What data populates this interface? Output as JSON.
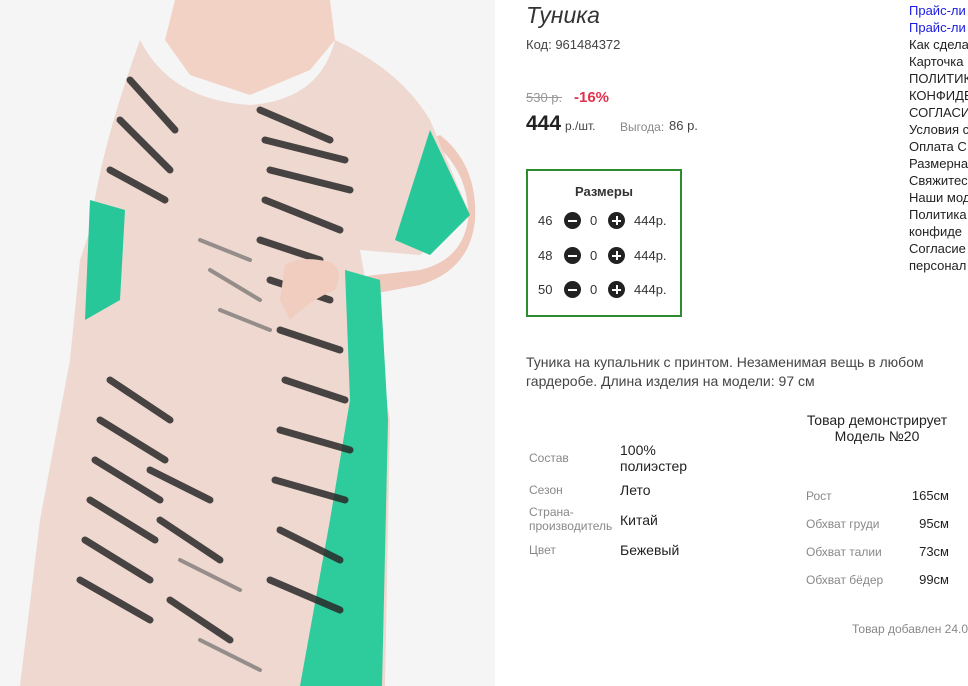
{
  "product": {
    "title": "Туника",
    "code": "Код: 961484372",
    "old_price": "530 р.",
    "discount": "-16%",
    "price": "444",
    "price_unit": "р./шт.",
    "savings_label": "Выгода:",
    "savings_value": "86 р."
  },
  "sizes": {
    "title": "Размеры",
    "rows": [
      {
        "size": "46",
        "qty": "0",
        "price": "444р."
      },
      {
        "size": "48",
        "qty": "0",
        "price": "444р."
      },
      {
        "size": "50",
        "qty": "0",
        "price": "444р."
      }
    ]
  },
  "description": "Туника на купальник с принтом. Незаменимая вещь в любом гардеробе. Длина изделия на модели: 97 см",
  "attributes": [
    {
      "label": "Состав",
      "value": "100% полиэстер"
    },
    {
      "label": "Сезон",
      "value": "Лето"
    },
    {
      "label": "Страна-производитель",
      "value": "Китай"
    },
    {
      "label": "Цвет",
      "value": "Бежевый"
    }
  ],
  "model": {
    "title": "Товар демонстрирует Модель №20",
    "measurements": [
      {
        "label": "Рост",
        "value": "165см"
      },
      {
        "label": "Обхват груди",
        "value": "95см"
      },
      {
        "label": "Обхват талии",
        "value": "73см"
      },
      {
        "label": "Обхват бёдер",
        "value": "99см"
      }
    ]
  },
  "added_text": "Товар добавлен 24.0",
  "side_links": [
    {
      "label": "Прайс-ли",
      "link": true
    },
    {
      "label": "Прайс-ли",
      "link": true
    },
    {
      "label": "Как сдела",
      "link": false
    },
    {
      "label": "Карточка",
      "link": false
    },
    {
      "label": "ПОЛИТИК",
      "link": false
    },
    {
      "label": "КОНФИДЕ",
      "link": false
    },
    {
      "label": "СОГЛАСИ",
      "link": false
    },
    {
      "label": "Условия с",
      "link": false
    },
    {
      "label": "Оплата С",
      "link": false
    },
    {
      "label": "Размерна",
      "link": false
    },
    {
      "label": "Свяжитес",
      "link": false
    },
    {
      "label": "Наши мод",
      "link": false
    },
    {
      "label": "Политика",
      "link": false
    },
    {
      "label": "конфиде",
      "link": false
    },
    {
      "label": "Согласие",
      "link": false
    },
    {
      "label": "персонал",
      "link": false
    }
  ],
  "colors": {
    "accent_green": "#2e8b2e",
    "discount_red": "#e0324b",
    "link_blue": "#1a1ae6",
    "tunic_teal": "#27c79a"
  },
  "icons": {
    "minus": "minus-circle-icon",
    "plus": "plus-circle-icon"
  }
}
